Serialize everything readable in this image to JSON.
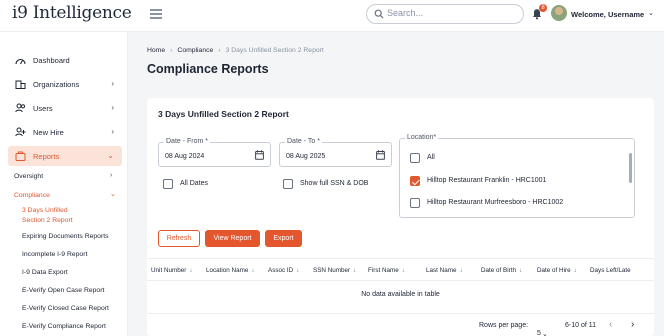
{
  "header": {
    "logo_prefix": "i9",
    "logo_text": "Intelligence",
    "search_placeholder": "Search...",
    "notification_count": "8",
    "welcome": "Welcome, Username"
  },
  "sidebar": {
    "items": [
      {
        "label": "Dashboard",
        "icon": "dashboard-icon"
      },
      {
        "label": "Organizations",
        "icon": "building-icon"
      },
      {
        "label": "Users",
        "icon": "users-icon"
      },
      {
        "label": "New Hire",
        "icon": "add-user-icon"
      },
      {
        "label": "Reports",
        "icon": "reports-icon"
      }
    ],
    "oversight": "Oversight",
    "compliance": "Compliance",
    "compliance_items": [
      "3 Days Unfilled",
      "Section 2 Report",
      "Expiring Documents Reports",
      "Incomplete I-9 Report",
      "I-9 Data Export",
      "E-Verify Open Case Report",
      "E-Verify Closed Case Report",
      "E-Verify Compliance Report"
    ]
  },
  "breadcrumb": {
    "home": "Home",
    "compliance": "Compliance",
    "current": "3 Days Unfilled Section 2 Report"
  },
  "page": {
    "title": "Compliance Reports"
  },
  "report": {
    "title": "3 Days Unfilled Section 2 Report",
    "date_from_label": "Date - From *",
    "date_from_value": "08 Aug 2024",
    "date_to_label": "Date - To *",
    "date_to_value": "08 Aug 2025",
    "all_dates_label": "All Dates",
    "show_ssn_label": "Show full SSN & DOB",
    "location_label": "Location*",
    "locations": [
      {
        "label": "All",
        "checked": false
      },
      {
        "label": "Hilltop Restaurant Franklin - HRC1001",
        "checked": true
      },
      {
        "label": "Hilltop Restaurant Murfreesboro - HRC1002",
        "checked": false
      }
    ],
    "buttons": {
      "refresh": "Refresh",
      "view": "View Report",
      "export": "Export"
    }
  },
  "table": {
    "columns": [
      "Unit Number",
      "Location Name",
      "Assoc ID",
      "SSN Number",
      "First Name",
      "Last Name",
      "Date of Birth",
      "Date of Hire",
      "Days Left/Late"
    ],
    "sort_arrow": "↓",
    "empty_text": "No data available in table",
    "rows_per_page_label": "Rows per page:",
    "rows_per_page_value": "5",
    "range": "6-10 of 11"
  },
  "colors": {
    "accent": "#e4572e",
    "accent_light": "#fbe3da",
    "text": "#1d2433",
    "background": "#f4f5f7"
  }
}
